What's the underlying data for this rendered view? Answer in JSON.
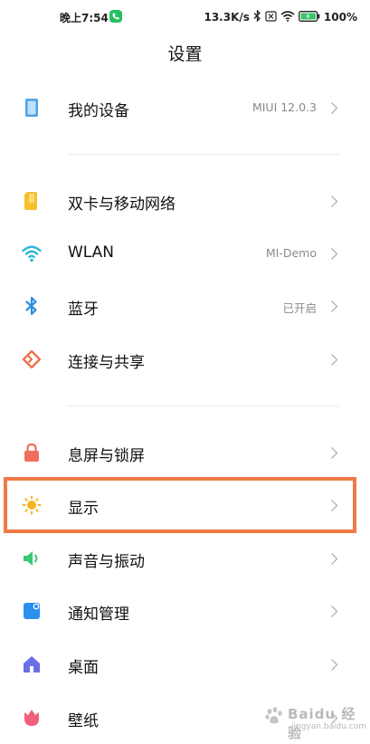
{
  "status_bar": {
    "time": "晚上7:54",
    "speed": "13.3K/s",
    "battery": "100%"
  },
  "header": {
    "title": "设置"
  },
  "items": [
    {
      "label": "我的设备",
      "value": "MIUI 12.0.3",
      "icon": "device-icon",
      "color": "#4aa3e8"
    },
    {
      "label": "双卡与移动网络",
      "value": "",
      "icon": "sim-card-icon",
      "color": "#f5c02c"
    },
    {
      "label": "WLAN",
      "value": "MI-Demo",
      "icon": "wifi-icon",
      "color": "#2fb6d8"
    },
    {
      "label": "蓝牙",
      "value": "已开启",
      "icon": "bluetooth-icon",
      "color": "#2f8ee0"
    },
    {
      "label": "连接与共享",
      "value": "",
      "icon": "share-icon",
      "color": "#ef7350"
    },
    {
      "label": "息屏与锁屏",
      "value": "",
      "icon": "lock-icon",
      "color": "#f06d5c"
    },
    {
      "label": "显示",
      "value": "",
      "icon": "sun-icon",
      "color": "#f6b420"
    },
    {
      "label": "声音与振动",
      "value": "",
      "icon": "speaker-icon",
      "color": "#3cc873"
    },
    {
      "label": "通知管理",
      "value": "",
      "icon": "notification-icon",
      "color": "#2b8ff0"
    },
    {
      "label": "桌面",
      "value": "",
      "icon": "home-icon",
      "color": "#6a6fe6"
    },
    {
      "label": "壁纸",
      "value": "",
      "icon": "tulip-icon",
      "color": "#f0607a"
    }
  ],
  "watermark": {
    "brand": "Baidu 经验",
    "sub": "jingyan.baidu.com"
  },
  "colors": {
    "highlight": "#ef7a45",
    "chevron": "#b5b5b5"
  }
}
